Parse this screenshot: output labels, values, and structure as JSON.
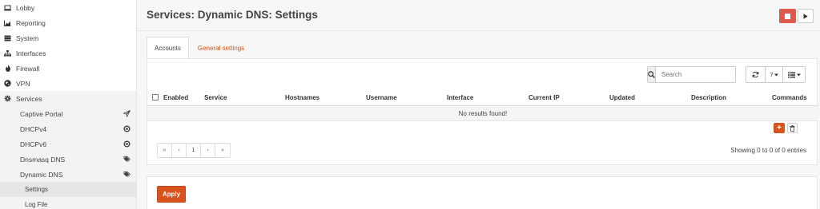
{
  "sidebar": {
    "items": [
      {
        "label": "Lobby",
        "icon": "laptop-icon"
      },
      {
        "label": "Reporting",
        "icon": "area-chart-icon"
      },
      {
        "label": "System",
        "icon": "server-icon"
      },
      {
        "label": "Interfaces",
        "icon": "sitemap-icon"
      },
      {
        "label": "Firewall",
        "icon": "fire-icon"
      },
      {
        "label": "VPN",
        "icon": "globe-icon"
      },
      {
        "label": "Services",
        "icon": "cog-icon"
      }
    ],
    "services_children": [
      {
        "label": "Captive Portal",
        "icon": "paper-plane-icon"
      },
      {
        "label": "DHCPv4",
        "icon": "bullseye-icon"
      },
      {
        "label": "DHCPv6",
        "icon": "bullseye-icon"
      },
      {
        "label": "Dnsmasq DNS",
        "icon": "tags-icon"
      },
      {
        "label": "Dynamic DNS",
        "icon": "tags-icon"
      }
    ],
    "dynamic_dns_children": [
      {
        "label": "Settings",
        "selected": true
      },
      {
        "label": "Log File",
        "selected": false
      }
    ]
  },
  "header": {
    "title": "Services: Dynamic DNS: Settings"
  },
  "tabs": [
    {
      "label": "Accounts",
      "active": true
    },
    {
      "label": "General settings",
      "active": false
    }
  ],
  "grid": {
    "search_placeholder": "Search",
    "page_size": "7",
    "columns": [
      "Enabled",
      "Service",
      "Hostnames",
      "Username",
      "Interface",
      "Current IP",
      "Updated",
      "Description",
      "Commands"
    ],
    "empty_message": "No results found!",
    "pagination": [
      "«",
      "‹",
      "1",
      "›",
      "»"
    ],
    "info": "Showing 0 to 0 of 0 entries"
  },
  "apply_label": "Apply",
  "colors": {
    "accent": "#d9531e",
    "stop": "#e2574c"
  }
}
